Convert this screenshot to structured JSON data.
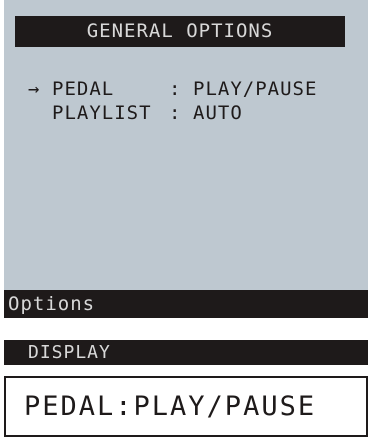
{
  "screen": {
    "header_title": "GENERAL OPTIONS",
    "menu": [
      {
        "selected": true,
        "cursor": "→",
        "name": "PEDAL",
        "separator": ":",
        "value": "PLAY/PAUSE"
      },
      {
        "selected": false,
        "cursor": "",
        "name": "PLAYLIST",
        "separator": ":",
        "value": "AUTO"
      }
    ],
    "footer_label": "Options"
  },
  "display": {
    "label": "DISPLAY",
    "text": "PEDAL:PLAY/PAUSE"
  },
  "colors": {
    "screen_bg": "#bec8d0",
    "bar_bg": "#1e1a1a",
    "bar_text": "#d8d8d8"
  }
}
